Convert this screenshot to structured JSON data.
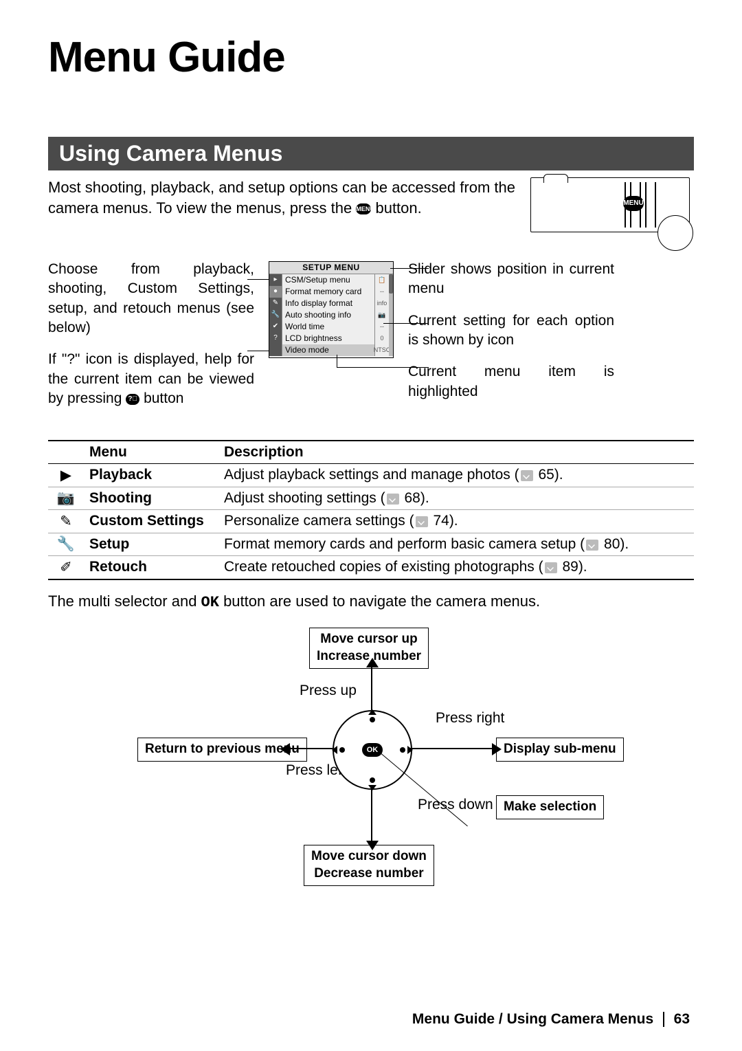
{
  "title": "Menu Guide",
  "section": "Using Camera Menus",
  "intro": {
    "text_before_btn": "Most shooting, playback, and setup options can be accessed from the camera menus.  To view the menus, press the ",
    "btn_label": "MENU",
    "text_after_btn": " button."
  },
  "camera_badge": "MENU",
  "left_notes": {
    "p1": "Choose from playback, shooting, Custom Settings, setup, and retouch menus (see below)",
    "p2_before": "If \"?\" icon is displayed, help for the current item can be viewed by pressing ",
    "p2_btn": "?",
    "p2_after": " button"
  },
  "right_notes": {
    "p1": "Slider shows position in current menu",
    "p2": "Current setting for each option is shown by icon",
    "p3": "Current menu item is highlighted"
  },
  "lcd": {
    "title": "SETUP MENU",
    "items": [
      {
        "label": "CSM/Setup menu",
        "val": "📋"
      },
      {
        "label": "Format memory card",
        "val": "--"
      },
      {
        "label": "Info display format",
        "val": "info"
      },
      {
        "label": "Auto shooting info",
        "val": "📷"
      },
      {
        "label": "World time",
        "val": "--"
      },
      {
        "label": "LCD brightness",
        "val": "0"
      },
      {
        "label": "Video mode",
        "val": "NTSC"
      }
    ],
    "left_icons": [
      "▸",
      "●",
      "✎",
      "🔧",
      "✔",
      "?"
    ]
  },
  "table": {
    "head_menu": "Menu",
    "head_desc": "Description",
    "rows": [
      {
        "icon": "▶",
        "name": "Playback",
        "desc": "Adjust playback settings and manage photos (",
        "page": "65",
        "desc_after": ")."
      },
      {
        "icon": "📷",
        "name": "Shooting",
        "desc": "Adjust shooting settings (",
        "page": "68",
        "desc_after": ")."
      },
      {
        "icon": "✎",
        "name": "Custom Settings",
        "desc": "Personalize camera settings (",
        "page": "74",
        "desc_after": ")."
      },
      {
        "icon": "🔧",
        "name": "Setup",
        "desc": "Format memory cards and perform basic camera setup (",
        "page": "80",
        "desc_after": ")."
      },
      {
        "icon": "✐",
        "name": "Retouch",
        "desc": "Create retouched copies of existing photographs (",
        "page": "89",
        "desc_after": ")."
      }
    ]
  },
  "nav_text_before": "The multi selector and ",
  "nav_ok": "OK",
  "nav_text_after": " button are used to navigate the camera menus.",
  "selector": {
    "up_box_l1": "Move cursor up",
    "up_box_l2": "Increase number",
    "left_box": "Return to previous menu",
    "right_box": "Display sub-menu",
    "down_box_l1": "Move cursor down",
    "down_box_l2": "Decrease number",
    "make_sel": "Make selection",
    "press_up": "Press up",
    "press_down": "Press down",
    "press_left": "Press left",
    "press_right": "Press right",
    "ok": "OK"
  },
  "footer": {
    "path": "Menu Guide / Using Camera Menus",
    "page": "63"
  }
}
